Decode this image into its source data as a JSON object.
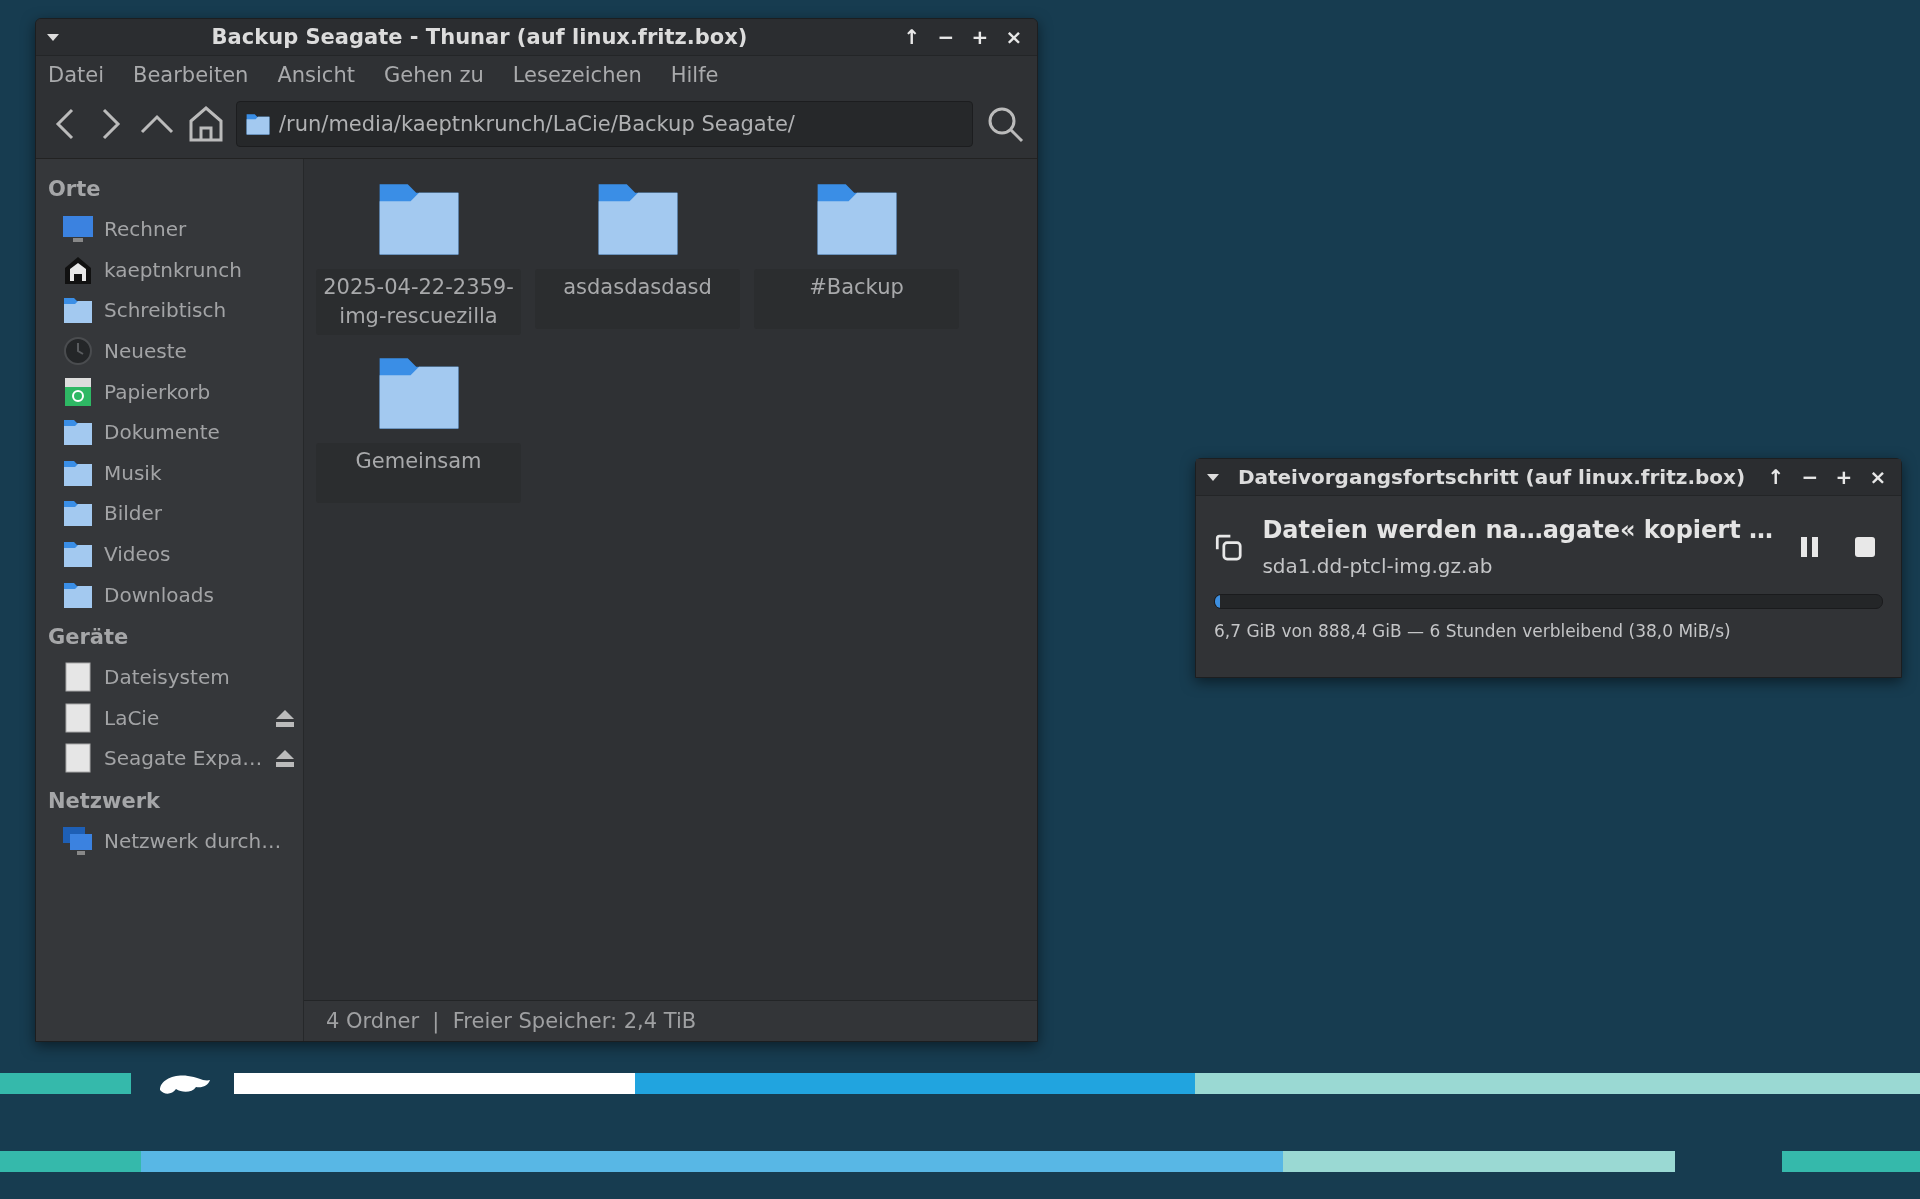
{
  "window": {
    "title": "Backup Seagate - Thunar (auf linux.fritz.box)",
    "controls": [
      "↑",
      "−",
      "+",
      "×"
    ],
    "menu": [
      "Datei",
      "Bearbeiten",
      "Ansicht",
      "Gehen zu",
      "Lesezeichen",
      "Hilfe"
    ],
    "path": "/run/media/kaeptnkrunch/LaCie/Backup Seagate/",
    "sidebar": [
      {
        "title": "Orte",
        "items": [
          {
            "label": "Rechner",
            "kind": "computer",
            "eject": false
          },
          {
            "label": "kaeptnkrunch",
            "kind": "home",
            "eject": false
          },
          {
            "label": "Schreibtisch",
            "kind": "folder",
            "eject": false
          },
          {
            "label": "Neueste",
            "kind": "recent",
            "eject": false
          },
          {
            "label": "Papierkorb",
            "kind": "trash",
            "eject": false
          },
          {
            "label": "Dokumente",
            "kind": "folder",
            "eject": false
          },
          {
            "label": "Musik",
            "kind": "folder",
            "eject": false
          },
          {
            "label": "Bilder",
            "kind": "folder",
            "eject": false
          },
          {
            "label": "Videos",
            "kind": "folder",
            "eject": false
          },
          {
            "label": "Downloads",
            "kind": "folder",
            "eject": false
          }
        ]
      },
      {
        "title": "Geräte",
        "items": [
          {
            "label": "Dateisystem",
            "kind": "drive",
            "eject": false
          },
          {
            "label": "LaCie",
            "kind": "drive",
            "eject": true
          },
          {
            "label": "Seagate Expa…",
            "kind": "drive",
            "eject": true
          }
        ]
      },
      {
        "title": "Netzwerk",
        "items": [
          {
            "label": "Netzwerk durch…",
            "kind": "network",
            "eject": false
          }
        ]
      }
    ],
    "folders": [
      {
        "name": "2025-04-22-2359-img-rescuezilla"
      },
      {
        "name": "asdasdasdasd"
      },
      {
        "name": "#Backup"
      },
      {
        "name": "Gemeinsam"
      }
    ],
    "status_bar": "4 Ordner  |  Freier Speicher: 2,4 TiB"
  },
  "dialog": {
    "title": "Dateivorgangsfortschritt (auf linux.fritz.box)",
    "controls": [
      "↑",
      "−",
      "+",
      "×"
    ],
    "heading": "Dateien werden na…agate« kopiert …",
    "file": "sda1.dd-ptcl-img.gz.ab",
    "level": 0.0075,
    "status": "6,7 GiB von 888,4 GiB — 6 Stunden verbleibend (38,0 MiB/s)"
  }
}
